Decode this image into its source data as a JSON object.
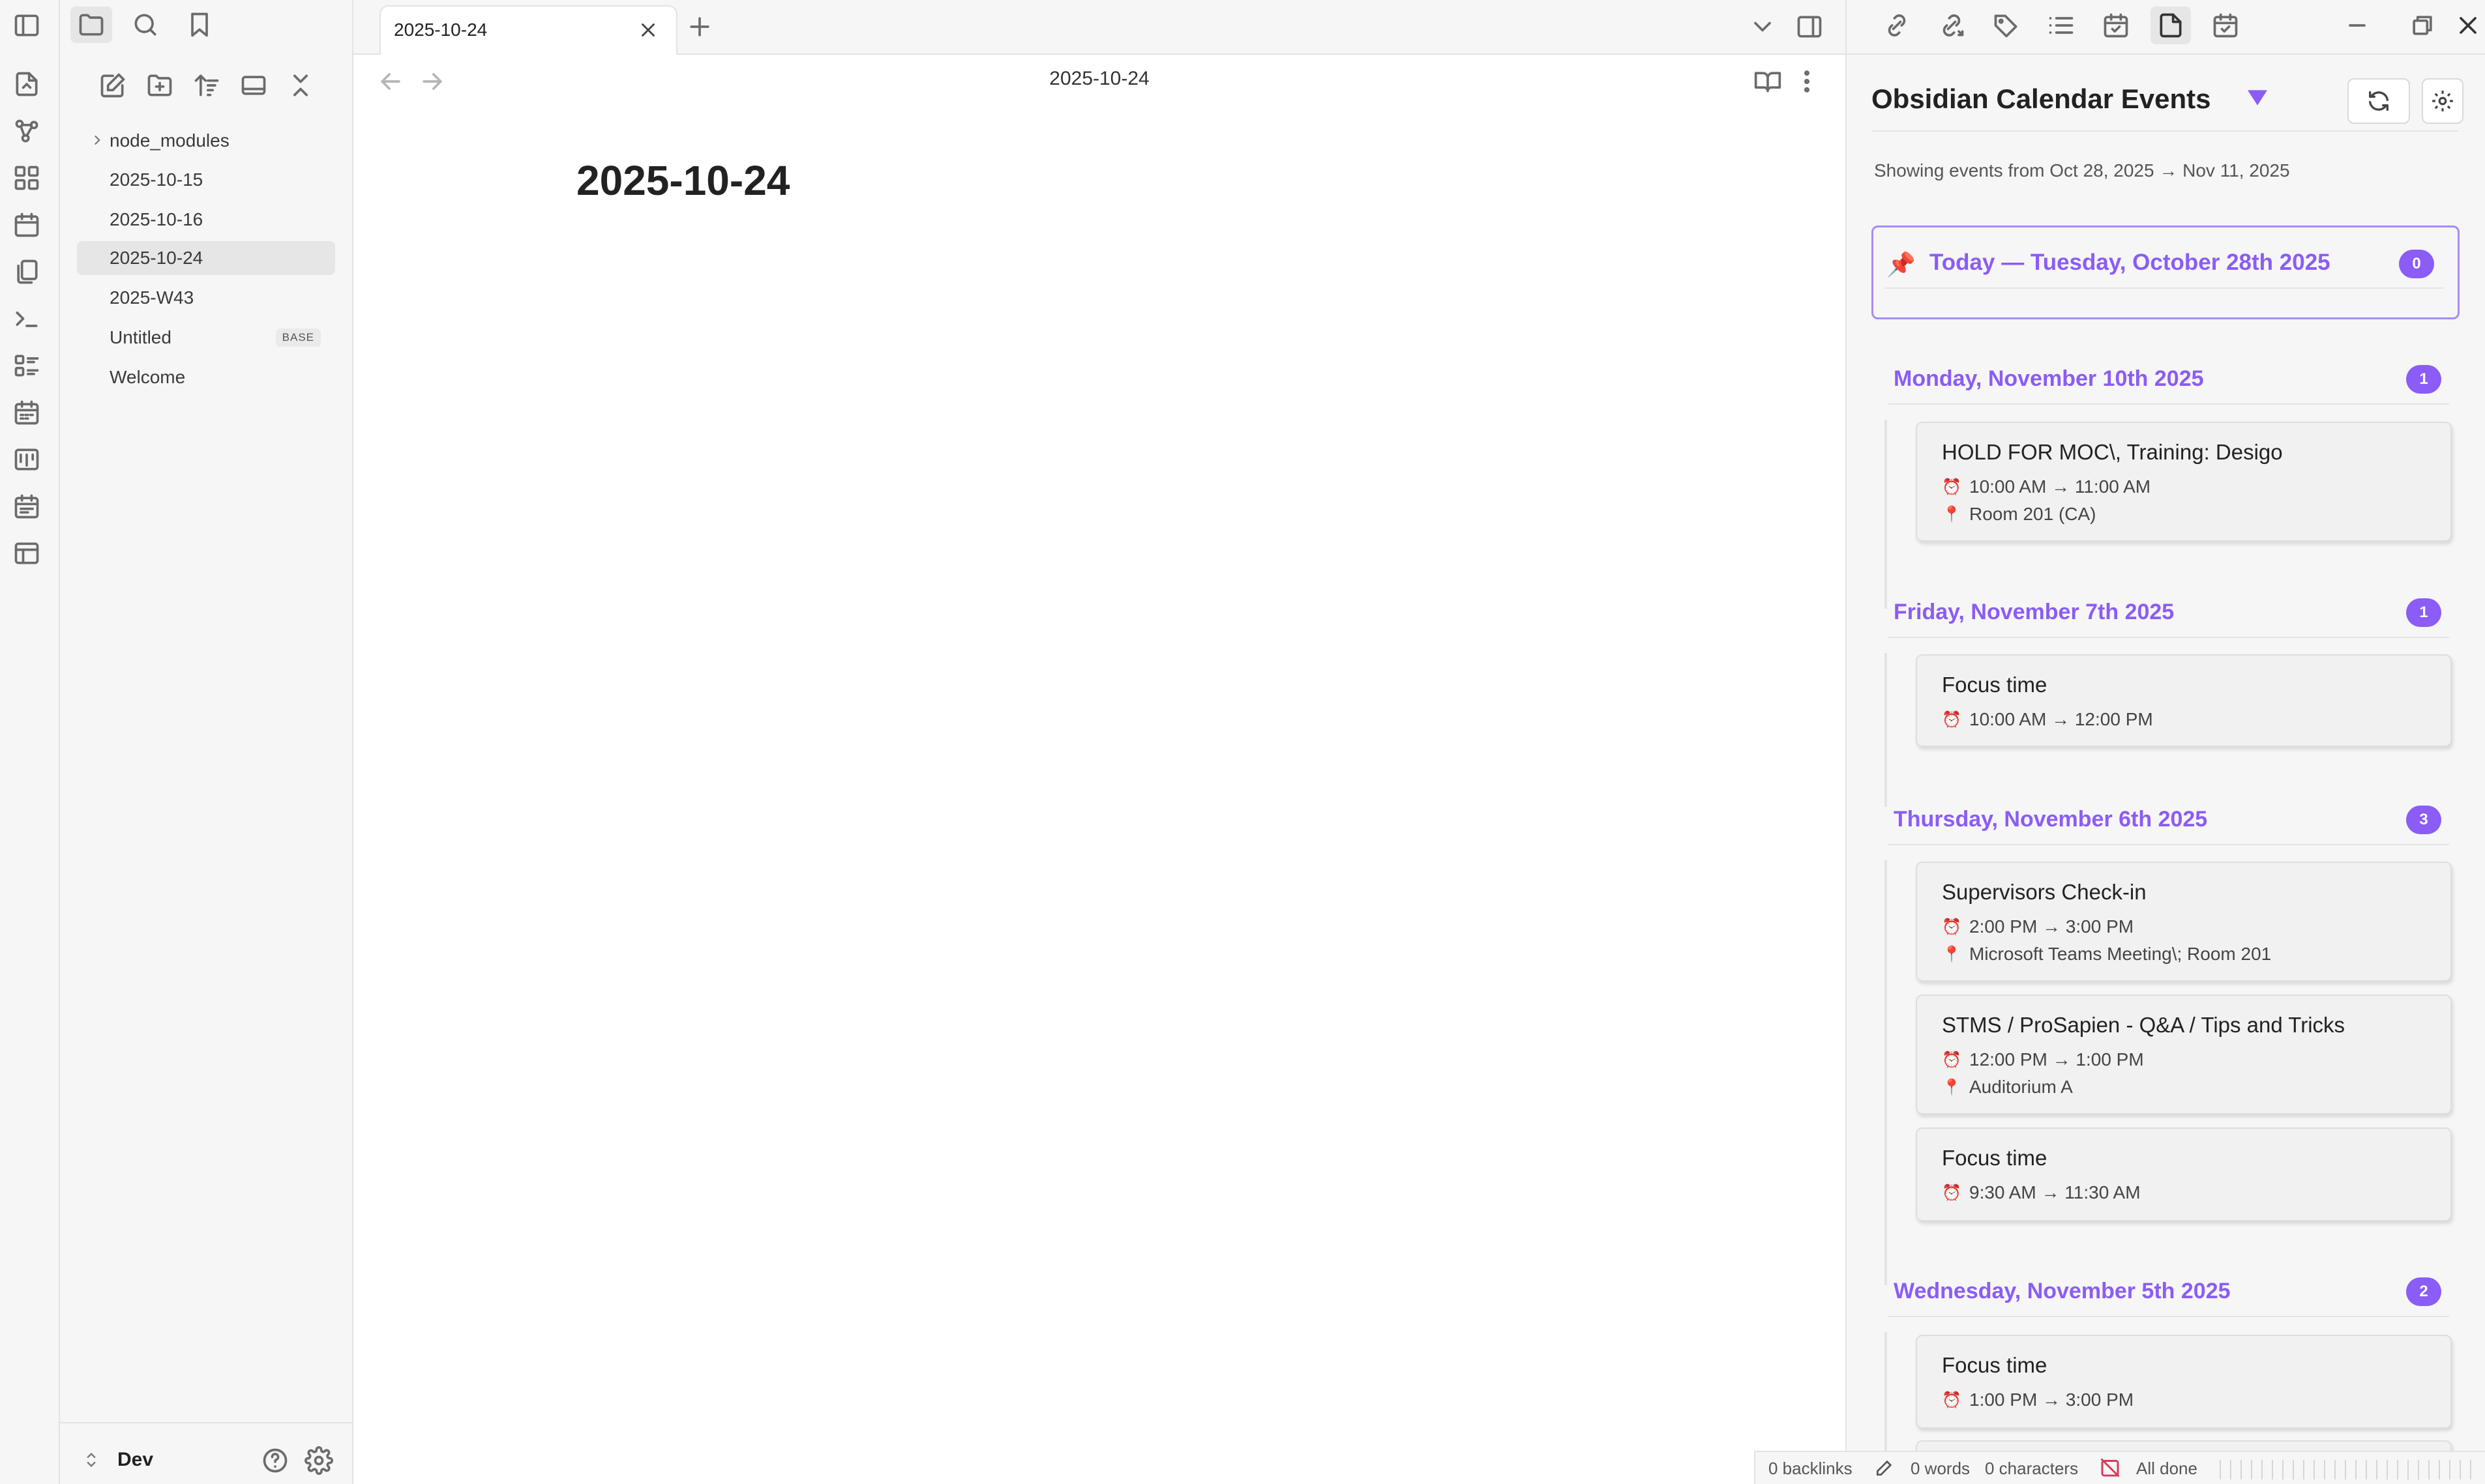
{
  "sidebar": {
    "files": [
      {
        "name": "node_modules",
        "folder": true
      },
      {
        "name": "2025-10-15"
      },
      {
        "name": "2025-10-16"
      },
      {
        "name": "2025-10-24",
        "active": true
      },
      {
        "name": "2025-W43"
      },
      {
        "name": "Untitled",
        "badge": "BASE"
      },
      {
        "name": "Welcome"
      }
    ],
    "vault_name": "Dev"
  },
  "tab": {
    "title": "2025-10-24"
  },
  "editor": {
    "view_title": "2025-10-24",
    "heading": "2025-10-24"
  },
  "panel": {
    "title": "Obsidian Calendar Events",
    "range": "Showing events from Oct 28, 2025 → Nov 11, 2025",
    "today": {
      "label": "Today — Tuesday, October 28th 2025",
      "count": "0"
    },
    "days": [
      {
        "label": "Monday, November 10th 2025",
        "count": "1",
        "events": [
          {
            "title": "HOLD FOR MOC\\, Training: Desigo",
            "time": "10:00 AM → 11:00 AM",
            "location": "Room 201 (CA)"
          }
        ]
      },
      {
        "label": "Friday, November 7th 2025",
        "count": "1",
        "events": [
          {
            "title": "Focus time",
            "time": "10:00 AM → 12:00 PM"
          }
        ]
      },
      {
        "label": "Thursday, November 6th 2025",
        "count": "3",
        "events": [
          {
            "title": "Supervisors Check-in",
            "time": "2:00 PM → 3:00 PM",
            "location": "Microsoft Teams Meeting\\; Room 201"
          },
          {
            "title": "STMS / ProSapien - Q&A / Tips and Tricks",
            "time": "12:00 PM → 1:00 PM",
            "location": "Auditorium A"
          },
          {
            "title": "Focus time",
            "time": "9:30 AM → 11:30 AM"
          }
        ]
      },
      {
        "label": "Wednesday, November 5th 2025",
        "count": "2",
        "events": [
          {
            "title": "Focus time",
            "time": "1:00 PM → 3:00 PM"
          }
        ]
      }
    ]
  },
  "status": {
    "backlinks": "0 backlinks",
    "words": "0 words",
    "characters": "0 characters",
    "sync": "All done"
  },
  "colors": {
    "accent": "#8b5cf6",
    "pin": "#d33d5d"
  },
  "icons": {
    "time": "alarm-clock-icon",
    "location": "pin-icon",
    "today": "pushpin-icon"
  }
}
